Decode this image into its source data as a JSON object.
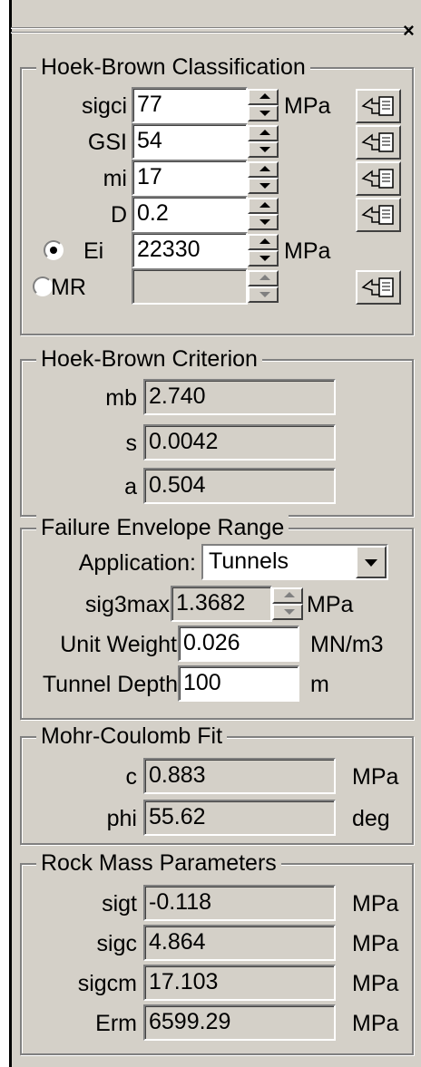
{
  "hoek_brown_classification": {
    "legend": "Hoek-Brown Classification",
    "rows": [
      {
        "label": "sigci",
        "value": "77",
        "unit": "MPa"
      },
      {
        "label": "GSI",
        "value": "54",
        "unit": ""
      },
      {
        "label": "mi",
        "value": "17",
        "unit": ""
      },
      {
        "label": "D",
        "value": "0.2",
        "unit": ""
      }
    ],
    "ei": {
      "label": "Ei",
      "value": "22330",
      "unit": "MPa",
      "selected": true
    },
    "mr": {
      "label": "MR",
      "value": "",
      "selected": false
    }
  },
  "hoek_brown_criterion": {
    "legend": "Hoek-Brown Criterion",
    "rows": [
      {
        "label": "mb",
        "value": "2.740"
      },
      {
        "label": "s",
        "value": "0.0042"
      },
      {
        "label": "a",
        "value": "0.504"
      }
    ]
  },
  "failure_envelope": {
    "legend": "Failure Envelope Range",
    "application_label": "Application:",
    "application_value": "Tunnels",
    "sig3max_label": "sig3max",
    "sig3max_value": "1.3682",
    "sig3max_unit": "MPa",
    "unit_weight_label": "Unit Weight",
    "unit_weight_value": "0.026",
    "unit_weight_unit": "MN/m3",
    "tunnel_depth_label": "Tunnel Depth",
    "tunnel_depth_value": "100",
    "tunnel_depth_unit": "m"
  },
  "mohr_coulomb": {
    "legend": "Mohr-Coulomb Fit",
    "rows": [
      {
        "label": "c",
        "value": "0.883",
        "unit": "MPa"
      },
      {
        "label": "phi",
        "value": "55.62",
        "unit": "deg"
      }
    ]
  },
  "rock_mass": {
    "legend": "Rock Mass Parameters",
    "rows": [
      {
        "label": "sigt",
        "value": "-0.118",
        "unit": "MPa"
      },
      {
        "label": "sigc",
        "value": "4.864",
        "unit": "MPa"
      },
      {
        "label": "sigcm",
        "value": "17.103",
        "unit": "MPa"
      },
      {
        "label": "Erm",
        "value": "6599.29",
        "unit": "MPa"
      }
    ]
  },
  "icons": {
    "close": "close-icon",
    "pick": "pick-value-hand-icon"
  },
  "colors": {
    "panel": "#d4d0c8",
    "field": "#ffffff"
  }
}
